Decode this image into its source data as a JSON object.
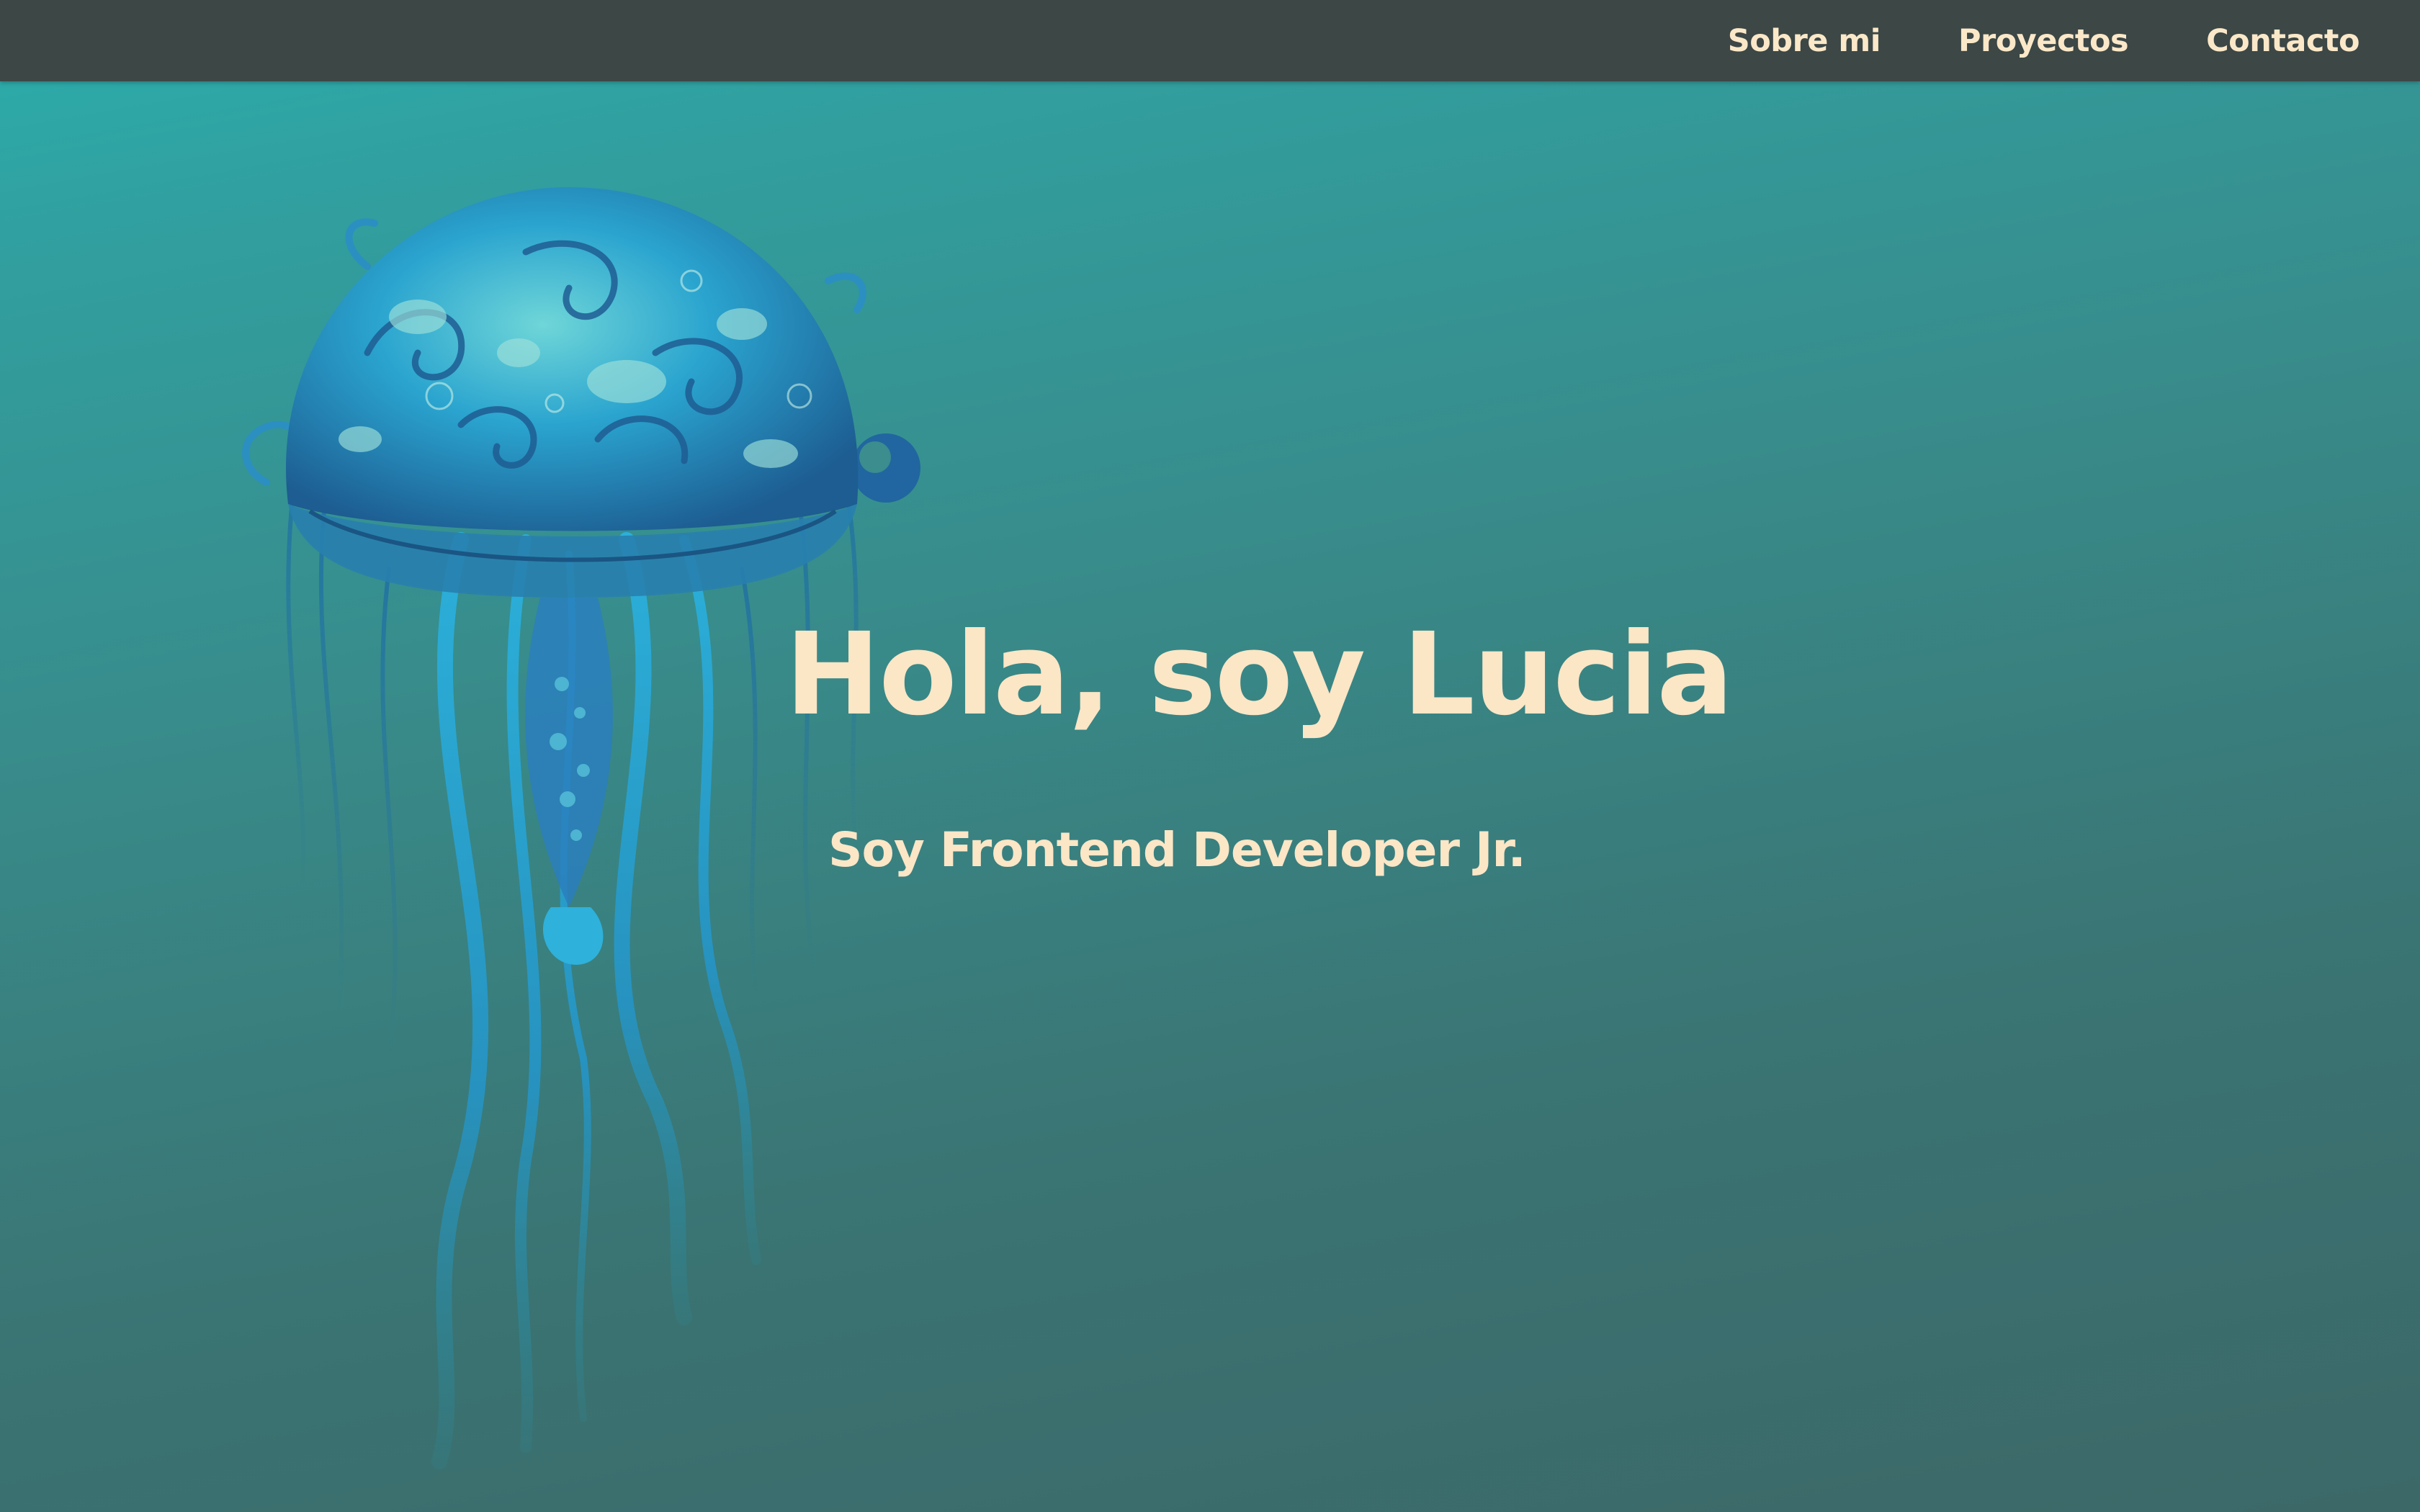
{
  "nav": {
    "items": [
      {
        "label": "Sobre mi"
      },
      {
        "label": "Proyectos"
      },
      {
        "label": "Contacto"
      }
    ]
  },
  "hero": {
    "title": "Hola, soy Lucia",
    "subtitle": "Soy Frontend Developer Jr."
  },
  "illustration": {
    "icon": "jellyfish-illustration"
  },
  "colors": {
    "navbar_bg": "#3c4746",
    "text_cream": "#fbe6c6",
    "gradient_top": "#2aafad",
    "gradient_bottom": "#3c6868",
    "jelly_light": "#2ab3d8",
    "jelly_dark": "#1f5f93"
  }
}
